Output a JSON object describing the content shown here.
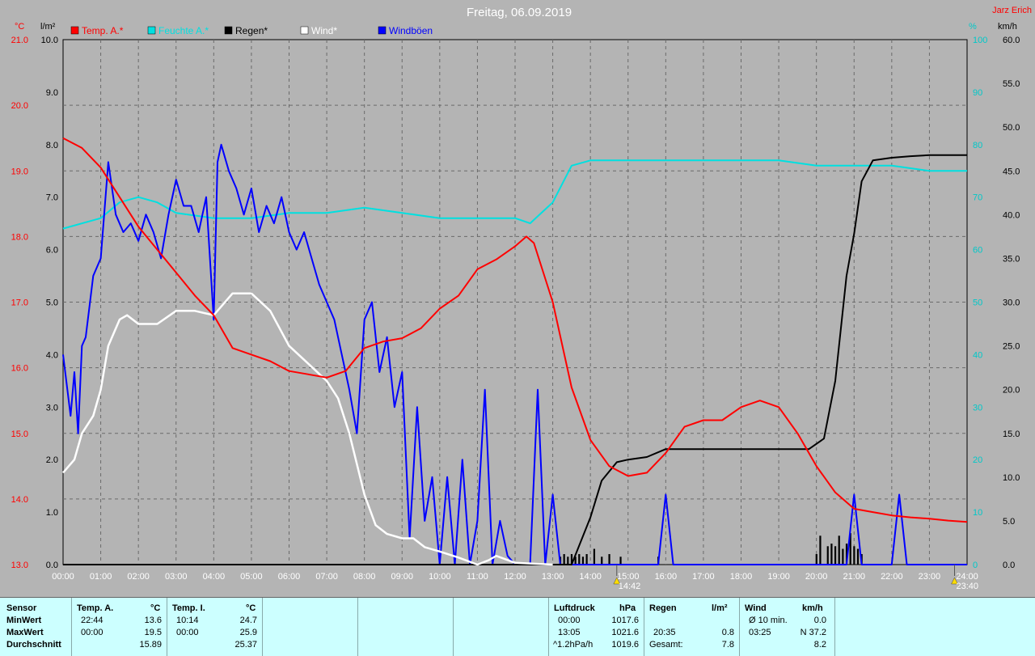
{
  "chart_data": {
    "type": "line",
    "title": "Freitag, 06.09.2019",
    "author": "Jarz Erich",
    "x_range_hours": [
      0,
      24
    ],
    "x_ticks": [
      "00:00",
      "01:00",
      "02:00",
      "03:00",
      "04:00",
      "05:00",
      "06:00",
      "07:00",
      "08:00",
      "09:00",
      "10:00",
      "11:00",
      "12:00",
      "13:00",
      "14:00",
      "15:00",
      "16:00",
      "17:00",
      "18:00",
      "19:00",
      "20:00",
      "21:00",
      "22:00",
      "23:00",
      "24:00"
    ],
    "axes": {
      "temp": {
        "unit": "°C",
        "range": [
          13.0,
          21.0
        ],
        "ticks": [
          "13.0",
          "14.0",
          "15.0",
          "16.0",
          "17.0",
          "18.0",
          "19.0",
          "20.0",
          "21.0"
        ],
        "color": "#ff0000"
      },
      "rain": {
        "unit": "l/m²",
        "range": [
          0.0,
          10.0
        ],
        "ticks": [
          "0.0",
          "1.0",
          "2.0",
          "3.0",
          "4.0",
          "5.0",
          "6.0",
          "7.0",
          "8.0",
          "9.0",
          "10.0"
        ],
        "color": "#000000"
      },
      "humidity": {
        "unit": "%",
        "range": [
          0,
          100
        ],
        "ticks": [
          "0",
          "10",
          "20",
          "30",
          "40",
          "50",
          "60",
          "70",
          "80",
          "90",
          "100"
        ],
        "color": "#00c8c8"
      },
      "wind": {
        "unit": "km/h",
        "range": [
          0.0,
          60.0
        ],
        "ticks": [
          "0.0",
          "5.0",
          "10.0",
          "15.0",
          "20.0",
          "25.0",
          "30.0",
          "35.0",
          "40.0",
          "45.0",
          "50.0",
          "55.0",
          "60.0"
        ],
        "color": "#000000"
      }
    },
    "grid": true,
    "legend": [
      {
        "name": "Temp. A.*",
        "color": "#ff0000"
      },
      {
        "name": "Feuchte A.*",
        "color": "#00e0e0"
      },
      {
        "name": "Regen*",
        "color": "#000000"
      },
      {
        "name": "Wind*",
        "color": "#ffffff"
      },
      {
        "name": "Windböen",
        "color": "#0000ff"
      }
    ],
    "markers": [
      {
        "time": "14:42",
        "hour": 14.7
      },
      {
        "time": "23:40",
        "hour": 23.667
      }
    ],
    "series": [
      {
        "name": "Temp. A.*",
        "axis": "temp",
        "color": "#ff0000",
        "x": [
          0,
          0.5,
          1,
          1.5,
          2,
          2.5,
          3,
          3.5,
          4,
          4.5,
          5,
          5.5,
          6,
          6.5,
          7,
          7.5,
          8,
          8.5,
          9,
          9.5,
          10,
          10.5,
          11,
          11.5,
          12,
          12.3,
          12.5,
          13,
          13.5,
          14,
          14.5,
          15,
          15.5,
          16,
          16.5,
          17,
          17.5,
          18,
          18.5,
          19,
          19.5,
          20,
          20.5,
          21,
          21.5,
          22,
          22.5,
          23,
          23.5,
          24
        ],
        "y": [
          19.5,
          19.35,
          19.05,
          18.6,
          18.15,
          17.8,
          17.45,
          17.1,
          16.8,
          16.3,
          16.2,
          16.1,
          15.95,
          15.9,
          15.85,
          15.95,
          16.3,
          16.4,
          16.45,
          16.6,
          16.9,
          17.1,
          17.5,
          17.65,
          17.85,
          18.0,
          17.9,
          17.0,
          15.7,
          14.9,
          14.5,
          14.35,
          14.4,
          14.7,
          15.1,
          15.2,
          15.2,
          15.4,
          15.5,
          15.4,
          15.0,
          14.5,
          14.1,
          13.85,
          13.8,
          13.75,
          13.72,
          13.7,
          13.67,
          13.65
        ]
      },
      {
        "name": "Feuchte A.*",
        "axis": "humidity",
        "color": "#00e0e0",
        "x": [
          0,
          1,
          1.5,
          2,
          2.5,
          3,
          4,
          5,
          6,
          7,
          8,
          9,
          10,
          11,
          12,
          12.4,
          13,
          13.5,
          14,
          15,
          16,
          17,
          18,
          19,
          20,
          21,
          22,
          23,
          24
        ],
        "y": [
          64,
          66,
          69,
          70,
          69,
          67,
          66,
          66,
          67,
          67,
          68,
          67,
          66,
          66,
          66,
          65,
          69,
          76,
          77,
          77,
          77,
          77,
          77,
          77,
          76,
          76,
          76,
          75,
          75
        ]
      },
      {
        "name": "Regen*",
        "axis": "rain",
        "color": "#000000",
        "x": [
          0,
          13.5,
          14,
          14.3,
          14.7,
          15,
          15.5,
          16,
          16.5,
          17,
          18,
          19,
          19.8,
          20.2,
          20.5,
          20.8,
          21,
          21.2,
          21.5,
          22,
          22.5,
          23,
          24
        ],
        "y": [
          0,
          0,
          0.9,
          1.6,
          1.95,
          2.0,
          2.05,
          2.2,
          2.2,
          2.2,
          2.2,
          2.2,
          2.2,
          2.4,
          3.5,
          5.5,
          6.3,
          7.3,
          7.7,
          7.75,
          7.78,
          7.8,
          7.8
        ]
      },
      {
        "name": "Wind*",
        "axis": "wind",
        "color": "#ffffff",
        "x": [
          0,
          0.3,
          0.5,
          0.8,
          1,
          1.2,
          1.5,
          1.7,
          2,
          2.5,
          3,
          3.5,
          4,
          4.5,
          5,
          5.5,
          6,
          6.5,
          7,
          7.3,
          7.6,
          8,
          8.3,
          8.6,
          9,
          9.3,
          9.6,
          10,
          10.5,
          11,
          11.3,
          11.5,
          12,
          12.5,
          13
        ],
        "y": [
          10.5,
          12,
          15,
          17,
          20,
          25,
          28,
          28.5,
          27.5,
          27.5,
          29,
          29,
          28.5,
          31,
          31,
          29,
          25,
          23,
          21,
          19,
          15,
          8,
          4.5,
          3.5,
          3,
          3,
          2,
          1.5,
          0.8,
          0,
          0.5,
          1,
          0.2,
          0.1,
          0
        ]
      },
      {
        "name": "Windböen",
        "axis": "wind",
        "color": "#0000ff",
        "x": [
          0,
          0.2,
          0.3,
          0.4,
          0.5,
          0.6,
          0.8,
          1,
          1.2,
          1.4,
          1.6,
          1.8,
          2,
          2.2,
          2.4,
          2.6,
          2.8,
          3,
          3.2,
          3.4,
          3.6,
          3.8,
          4,
          4.1,
          4.2,
          4.4,
          4.6,
          4.8,
          5,
          5.2,
          5.4,
          5.6,
          5.8,
          6,
          6.2,
          6.4,
          6.6,
          6.8,
          7,
          7.2,
          7.4,
          7.6,
          7.8,
          8,
          8.2,
          8.4,
          8.6,
          8.8,
          9,
          9.2,
          9.4,
          9.6,
          9.8,
          10,
          10.2,
          10.4,
          10.6,
          10.8,
          11,
          11.2,
          11.4,
          11.6,
          11.8,
          12,
          12.2,
          12.4,
          12.6,
          12.8,
          13,
          13.2,
          13.4,
          13.6,
          13.8,
          14,
          14.5,
          15,
          15.5,
          15.8,
          16,
          16.2,
          16.5,
          17,
          18,
          19,
          20,
          20.5,
          20.8,
          21,
          21.2,
          21.5,
          22,
          22.2,
          22.4,
          22.6,
          23,
          24
        ],
        "y": [
          24,
          17,
          22,
          15,
          25,
          26,
          33,
          35,
          46,
          40,
          38,
          39,
          37,
          40,
          38,
          35,
          40,
          44,
          41,
          41,
          38,
          42,
          28,
          46,
          48,
          45,
          43,
          40,
          43,
          38,
          41,
          39,
          42,
          38,
          36,
          38,
          35,
          32,
          30,
          28,
          24,
          20,
          15,
          28,
          30,
          22,
          26,
          18,
          22,
          3,
          18,
          5,
          10,
          0,
          10,
          0,
          12,
          0,
          5,
          20,
          0,
          5,
          1,
          0,
          0,
          0,
          20,
          0,
          8,
          0,
          0,
          0,
          0,
          0,
          0,
          0,
          0,
          0,
          8,
          0,
          0,
          0,
          0,
          0,
          0,
          0,
          0,
          8,
          0,
          0,
          0,
          8,
          0,
          0,
          0,
          0
        ]
      }
    ],
    "rain_bars": {
      "color": "#000000",
      "x": [
        13.2,
        13.3,
        13.4,
        13.5,
        13.6,
        13.7,
        13.8,
        13.9,
        14.1,
        14.3,
        14.5,
        14.8,
        15.8,
        20.0,
        20.1,
        20.3,
        20.4,
        20.5,
        20.6,
        20.7,
        20.8,
        20.9,
        21.0,
        21.1,
        21.2
      ],
      "h": [
        0.15,
        0.2,
        0.15,
        0.2,
        0.15,
        0.2,
        0.15,
        0.2,
        0.3,
        0.15,
        0.2,
        0.15,
        0.15,
        0.2,
        0.55,
        0.35,
        0.4,
        0.35,
        0.55,
        0.3,
        0.4,
        0.6,
        0.35,
        0.3,
        0.2
      ]
    }
  },
  "stats": {
    "sensor_header": "Sensor",
    "rows": [
      "MinWert",
      "MaxWert",
      "Durchschnitt"
    ],
    "temp_a": {
      "title": "Temp. A.",
      "unit": "°C",
      "min_time": "22:44",
      "min": "13.6",
      "max_time": "00:00",
      "max": "19.5",
      "avg": "15.89"
    },
    "temp_i": {
      "title": "Temp. I.",
      "unit": "°C",
      "min_time": "10:14",
      "min": "24.7",
      "max_time": "00:00",
      "max": "25.9",
      "avg": "25.37"
    },
    "pressure": {
      "title": "Luftdruck",
      "unit": "hPa",
      "min_time": "00:00",
      "min": "1017.6",
      "max_time": "13:05",
      "max": "1021.6",
      "avg_label": "^1.2hPa/h",
      "avg": "1019.6"
    },
    "rain": {
      "title": "Regen",
      "unit": "l/m²",
      "max_time": "20:35",
      "max": "0.8",
      "total_label": "Gesamt:",
      "total": "7.8"
    },
    "wind": {
      "title": "Wind",
      "unit": "km/h",
      "min_label": "Ø 10 min.",
      "min": "0.0",
      "max_time": "03:25",
      "max": "N 37.2",
      "avg": "8.2"
    }
  }
}
